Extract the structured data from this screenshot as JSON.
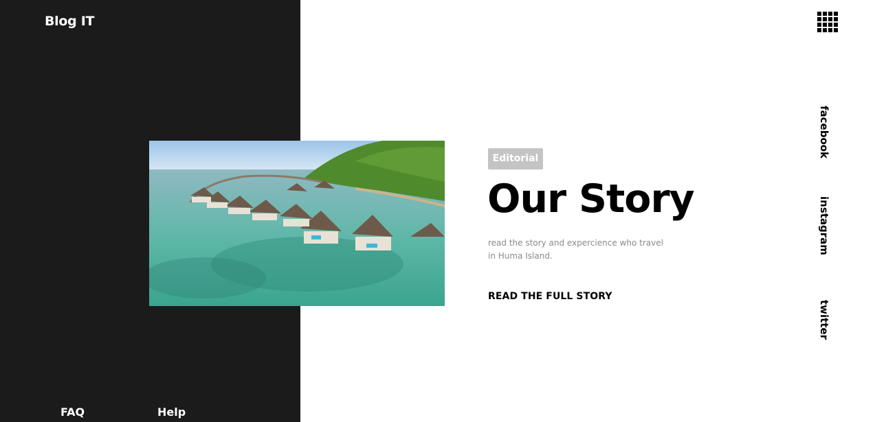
{
  "brand": {
    "name": "Blog IT"
  },
  "footer": {
    "links": [
      {
        "label": "FAQ"
      },
      {
        "label": "Help"
      }
    ]
  },
  "hero": {
    "tag": "Editorial",
    "title": "Our Story",
    "description": "read the story and expercience who travel in Huma Island.",
    "cta": "READ THE FULL STORY",
    "image": "overwater bungalows resort photo"
  },
  "social": [
    {
      "label": "facebook"
    },
    {
      "label": "instagram"
    },
    {
      "label": "twitter"
    }
  ],
  "icons": {
    "menu": "grid-menu-icon"
  },
  "colors": {
    "panel_dark": "#1b1b1b",
    "tag_bg": "#c4c4c4",
    "text_primary": "#000000",
    "text_muted": "#8a8a8a"
  }
}
